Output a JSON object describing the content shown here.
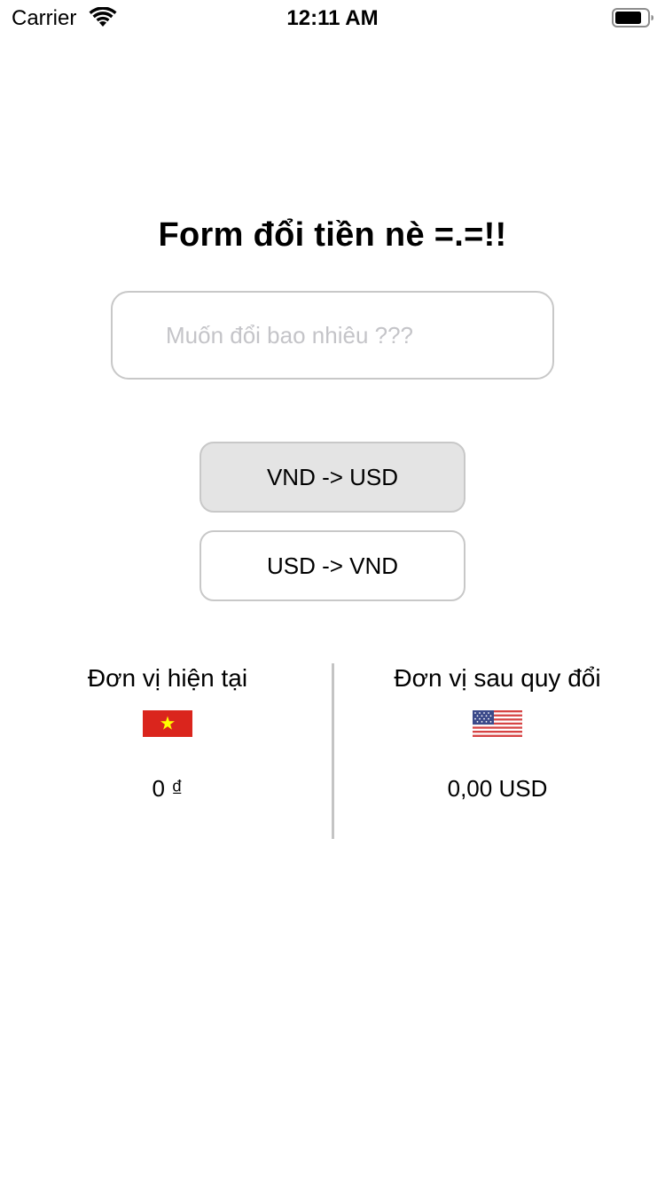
{
  "status_bar": {
    "carrier": "Carrier",
    "time": "12:11 AM",
    "icons": [
      "wifi-icon",
      "battery-icon"
    ]
  },
  "title": "Form đổi tiền nè =.=!!",
  "amount_input": {
    "value": "",
    "placeholder": "Muốn đổi bao nhiêu ???"
  },
  "buttons": {
    "vnd_to_usd": "VND -> USD",
    "usd_to_vnd": "USD -> VND",
    "selected": "vnd_to_usd"
  },
  "current_unit": {
    "label": "Đơn vị hiện tại",
    "flag": "vietnam-flag-icon",
    "value": "0 ₫"
  },
  "converted_unit": {
    "label": "Đơn vị sau quy đổi",
    "flag": "us-flag-icon",
    "value": "0,00 USD"
  },
  "colors": {
    "selected_button_bg": "#e4e4e4",
    "border": "#c8c8c8",
    "vn_flag_red": "#da251d",
    "vn_flag_star": "#ffff00",
    "us_flag_red": "#d64444",
    "us_flag_blue": "#3b4a8a"
  }
}
